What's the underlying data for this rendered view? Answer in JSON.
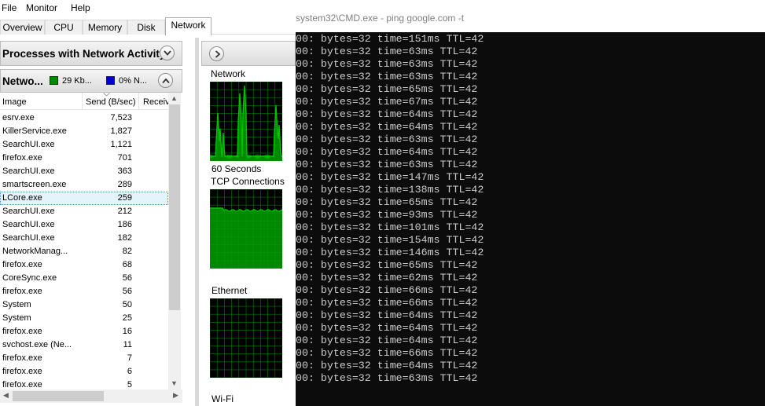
{
  "menu": [
    "File",
    "Monitor",
    "Help"
  ],
  "tabs": [
    {
      "label": "Overview",
      "active": false
    },
    {
      "label": "CPU",
      "active": false
    },
    {
      "label": "Memory",
      "active": false
    },
    {
      "label": "Disk",
      "active": false
    },
    {
      "label": "Network",
      "active": true
    }
  ],
  "processes_panel": {
    "title": "Processes with Network Activity"
  },
  "network_panel": {
    "title": "Netwo...",
    "legend": [
      {
        "text": "29 Kb...",
        "color": "#008a00"
      },
      {
        "text": "0% N...",
        "color": "#0000cc"
      }
    ]
  },
  "columns": [
    "Image",
    "Send (B/sec)",
    "Receiv"
  ],
  "rows": [
    {
      "image": "esrv.exe",
      "send": "7,523"
    },
    {
      "image": "KillerService.exe",
      "send": "1,827"
    },
    {
      "image": "SearchUI.exe",
      "send": "1,121"
    },
    {
      "image": "firefox.exe",
      "send": "701"
    },
    {
      "image": "SearchUI.exe",
      "send": "363"
    },
    {
      "image": "smartscreen.exe",
      "send": "289"
    },
    {
      "image": "LCore.exe",
      "send": "259",
      "selected": true
    },
    {
      "image": "SearchUI.exe",
      "send": "212"
    },
    {
      "image": "SearchUI.exe",
      "send": "186"
    },
    {
      "image": "SearchUI.exe",
      "send": "182"
    },
    {
      "image": "NetworkManag...",
      "send": "82"
    },
    {
      "image": "firefox.exe",
      "send": "68"
    },
    {
      "image": "CoreSync.exe",
      "send": "56"
    },
    {
      "image": "firefox.exe",
      "send": "56"
    },
    {
      "image": "System",
      "send": "50"
    },
    {
      "image": "System",
      "send": "25"
    },
    {
      "image": "firefox.exe",
      "send": "16"
    },
    {
      "image": "svchost.exe (Ne...",
      "send": "11"
    },
    {
      "image": "firefox.exe",
      "send": "7"
    },
    {
      "image": "firefox.exe",
      "send": "6"
    },
    {
      "image": "firefox.exe",
      "send": "5"
    }
  ],
  "graphs": {
    "network_label": "Network",
    "seconds_label": "60 Seconds",
    "tcp_label": "TCP Connections",
    "ethernet_label": "Ethernet",
    "wifi_label": "Wi-Fi",
    "line_color": "#00c000",
    "fill_color": "#00a000",
    "grid_color": "#007a00"
  },
  "cmd": {
    "title": "system32\\CMD.exe - ping  google.com -t",
    "lines": [
      "00: bytes=32 time=151ms TTL=42",
      "00: bytes=32 time=63ms TTL=42",
      "00: bytes=32 time=63ms TTL=42",
      "00: bytes=32 time=63ms TTL=42",
      "00: bytes=32 time=65ms TTL=42",
      "00: bytes=32 time=67ms TTL=42",
      "00: bytes=32 time=64ms TTL=42",
      "00: bytes=32 time=64ms TTL=42",
      "00: bytes=32 time=63ms TTL=42",
      "00: bytes=32 time=64ms TTL=42",
      "00: bytes=32 time=63ms TTL=42",
      "00: bytes=32 time=147ms TTL=42",
      "00: bytes=32 time=138ms TTL=42",
      "00: bytes=32 time=65ms TTL=42",
      "00: bytes=32 time=93ms TTL=42",
      "00: bytes=32 time=101ms TTL=42",
      "00: bytes=32 time=154ms TTL=42",
      "00: bytes=32 time=146ms TTL=42",
      "00: bytes=32 time=65ms TTL=42",
      "00: bytes=32 time=62ms TTL=42",
      "00: bytes=32 time=66ms TTL=42",
      "00: bytes=32 time=66ms TTL=42",
      "00: bytes=32 time=64ms TTL=42",
      "00: bytes=32 time=64ms TTL=42",
      "00: bytes=32 time=64ms TTL=42",
      "00: bytes=32 time=66ms TTL=42",
      "00: bytes=32 time=64ms TTL=42",
      "00: bytes=32 time=63ms TTL=42"
    ]
  }
}
